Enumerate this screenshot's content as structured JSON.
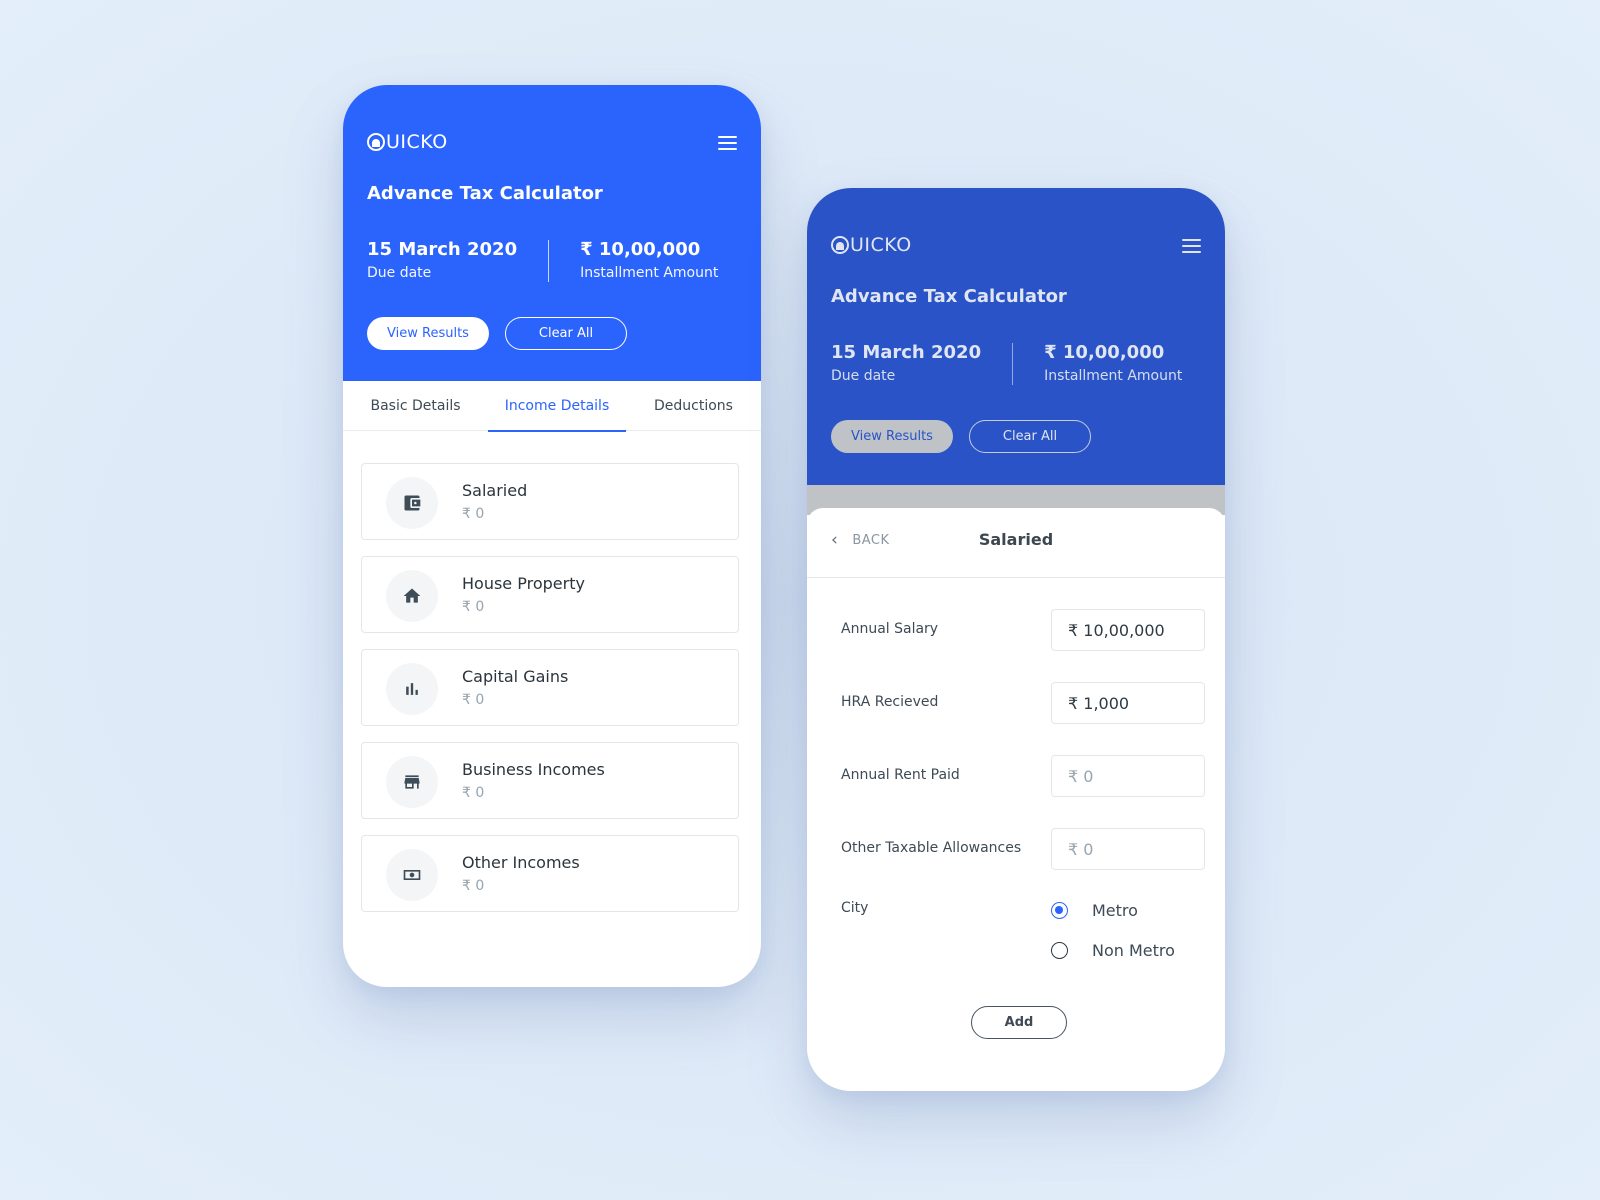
{
  "colors": {
    "primary": "#2b63fd",
    "primary_dimmed": "#2953c6",
    "background": "#e3eefa",
    "text_dark": "#2b343c",
    "text_muted": "#97a3ad"
  },
  "left_screen": {
    "header": {
      "logo": "UICKO",
      "menu_icon": "hamburger-menu-icon",
      "title": "Advance Tax Calculator",
      "due_date_value": "15 March 2020",
      "due_date_label": "Due date",
      "installment_value": "₹ 10,00,000",
      "installment_label": "Installment Amount",
      "view_results_label": "View Results",
      "clear_all_label": "Clear All"
    },
    "tabs": [
      {
        "label": "Basic Details",
        "active": false
      },
      {
        "label": "Income Details",
        "active": true
      },
      {
        "label": "Deductions",
        "active": false
      }
    ],
    "income_items": [
      {
        "title": "Salaried",
        "amount": "₹ 0",
        "icon": "wallet-icon"
      },
      {
        "title": "House Property",
        "amount": "₹ 0",
        "icon": "home-icon"
      },
      {
        "title": "Capital Gains",
        "amount": "₹ 0",
        "icon": "bar-chart-icon"
      },
      {
        "title": "Business Incomes",
        "amount": "₹ 0",
        "icon": "store-icon"
      },
      {
        "title": "Other Incomes",
        "amount": "₹ 0",
        "icon": "cash-icon"
      }
    ]
  },
  "right_screen": {
    "header": {
      "logo": "UICKO",
      "menu_icon": "hamburger-menu-icon",
      "title": "Advance Tax Calculator",
      "due_date_value": "15 March 2020",
      "due_date_label": "Due date",
      "installment_value": "₹ 10,00,000",
      "installment_label": "Installment Amount",
      "view_results_label": "View Results",
      "clear_all_label": "Clear All"
    },
    "sheet": {
      "back_label": "BACK",
      "title": "Salaried",
      "fields": [
        {
          "label": "Annual Salary",
          "value": "₹ 10,00,000",
          "is_placeholder": false
        },
        {
          "label": "HRA Recieved",
          "value": "₹ 1,000",
          "is_placeholder": false
        },
        {
          "label": "Annual Rent Paid",
          "value": "₹ 0",
          "is_placeholder": true
        },
        {
          "label": "Other Taxable Allowances",
          "value": "₹ 0",
          "is_placeholder": true
        }
      ],
      "city_label": "City",
      "city_options": [
        {
          "label": "Metro",
          "selected": true
        },
        {
          "label": "Non Metro",
          "selected": false
        }
      ],
      "add_label": "Add"
    }
  }
}
